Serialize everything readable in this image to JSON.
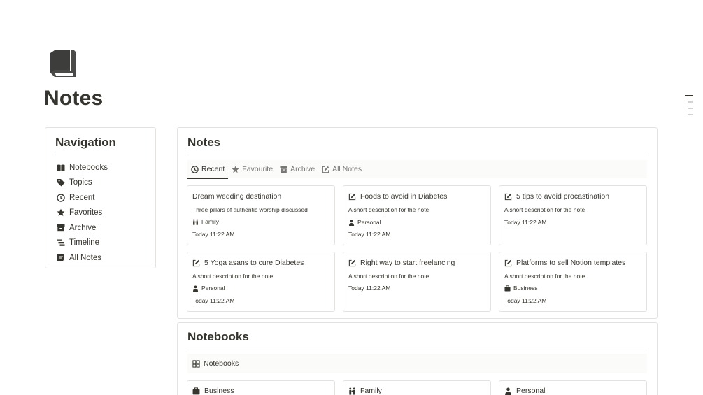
{
  "page": {
    "title": "Notes",
    "icon": "notebook-icon"
  },
  "navigation": {
    "title": "Navigation",
    "items": [
      {
        "label": "Notebooks",
        "icon": "book-open-icon"
      },
      {
        "label": "Topics",
        "icon": "tag-icon"
      },
      {
        "label": "Recent",
        "icon": "clock-icon"
      },
      {
        "label": "Favorites",
        "icon": "star-icon"
      },
      {
        "label": "Archive",
        "icon": "archive-icon"
      },
      {
        "label": "Timeline",
        "icon": "timeline-icon"
      },
      {
        "label": "All Notes",
        "icon": "note-icon"
      }
    ]
  },
  "notes": {
    "title": "Notes",
    "tabs": [
      {
        "label": "Recent",
        "icon": "clock-icon",
        "active": true
      },
      {
        "label": "Favourite",
        "icon": "star-icon",
        "active": false
      },
      {
        "label": "Archive",
        "icon": "archive-icon",
        "active": false
      },
      {
        "label": "All Notes",
        "icon": "edit-icon",
        "active": false
      }
    ],
    "cards": [
      {
        "title": "Dream wedding destination",
        "desc": "Three pillars of authentic worship discussed",
        "tag": "Family",
        "time": "Today 11:22 AM"
      },
      {
        "title": "Foods to avoid in Diabetes",
        "desc": "A short description for the note",
        "tag": "Personal",
        "time": "Today 11:22 AM"
      },
      {
        "title": "5 tips to avoid procastination",
        "desc": "A short description for the note",
        "tag": "",
        "time": "Today 11:22 AM"
      },
      {
        "title": "5 Yoga asans to cure Diabetes",
        "desc": "A short description for the note",
        "tag": "Personal",
        "time": "Today 11:22 AM"
      },
      {
        "title": "Right way to start freelancing",
        "desc": "A short description for the note",
        "tag": "",
        "time": "Today 11:22 AM"
      },
      {
        "title": "Platforms to sell Notion templates",
        "desc": "A short description for the note",
        "tag": "Business",
        "time": "Today 11:22 AM"
      }
    ]
  },
  "notebooks": {
    "title": "Notebooks",
    "view_label": "Notebooks",
    "cards": [
      {
        "label": "Business",
        "icon": "briefcase-icon"
      },
      {
        "label": "Family",
        "icon": "family-icon"
      },
      {
        "label": "Personal",
        "icon": "person-icon"
      }
    ]
  }
}
